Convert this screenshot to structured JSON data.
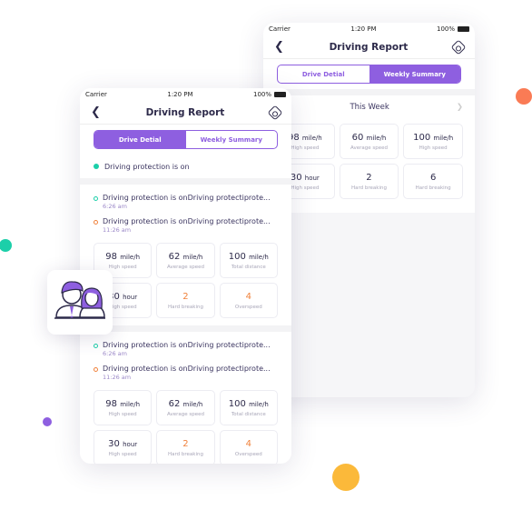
{
  "colors": {
    "accent": "#8e5fe0",
    "teal": "#1ccfa9",
    "orange": "#f0823c",
    "yellow": "#fbb93a",
    "coral": "#fa7b55"
  },
  "status": {
    "carrier": "Carrier",
    "time": "1:20 PM",
    "battery": "100%"
  },
  "back_screen": {
    "title": "Driving Report",
    "tabs": [
      {
        "label": "Drive Detial",
        "active": false
      },
      {
        "label": "Weekly Summary",
        "active": true
      }
    ],
    "week_label": "This Week",
    "cards": [
      {
        "value": "98",
        "unit": "mile/h",
        "label": "High speed"
      },
      {
        "value": "60",
        "unit": "mile/h",
        "label": "Average speed"
      },
      {
        "value": "100",
        "unit": "mile/h",
        "label": "High speed"
      },
      {
        "value": "30",
        "unit": "hour",
        "label": "High speed"
      },
      {
        "value": "2",
        "unit": "",
        "label": "Hard breaking"
      },
      {
        "value": "6",
        "unit": "",
        "label": "Hard breaking"
      }
    ]
  },
  "front_screen": {
    "title": "Driving Report",
    "tabs": [
      {
        "label": "Drive Detial",
        "active": true
      },
      {
        "label": "Weekly Summary",
        "active": false
      }
    ],
    "protection_status": "Driving protection is on",
    "sections": [
      {
        "events": [
          {
            "text": "Driving protection is onDriving protectiprote...",
            "time": "6:26 am",
            "color": "teal"
          },
          {
            "text": "Driving protection is onDriving protectiprote...",
            "time": "11:26 am",
            "color": "orange"
          }
        ],
        "cards": [
          {
            "value": "98",
            "unit": "mile/h",
            "label": "High speed"
          },
          {
            "value": "62",
            "unit": "mile/h",
            "label": "Average speed"
          },
          {
            "value": "100",
            "unit": "mile/h",
            "label": "Total distance"
          },
          {
            "value": "30",
            "unit": "hour",
            "label": "High speed"
          },
          {
            "value": "2",
            "unit": "",
            "label": "Hard breaking",
            "warn": true
          },
          {
            "value": "4",
            "unit": "",
            "label": "Overspeed",
            "warn": true
          }
        ]
      },
      {
        "events": [
          {
            "text": "Driving protection is onDriving protectiprote...",
            "time": "6:26 am",
            "color": "teal"
          },
          {
            "text": "Driving protection is onDriving protectiprote...",
            "time": "11:26 am",
            "color": "orange"
          }
        ],
        "cards": [
          {
            "value": "98",
            "unit": "mile/h",
            "label": "High speed"
          },
          {
            "value": "62",
            "unit": "mile/h",
            "label": "Average speed"
          },
          {
            "value": "100",
            "unit": "mile/h",
            "label": "Total distance"
          },
          {
            "value": "30",
            "unit": "hour",
            "label": "High speed"
          },
          {
            "value": "2",
            "unit": "",
            "label": "Hard breaking",
            "warn": true
          },
          {
            "value": "4",
            "unit": "",
            "label": "Overspeed",
            "warn": true
          }
        ]
      }
    ]
  },
  "avatar_icon": "users-icon"
}
